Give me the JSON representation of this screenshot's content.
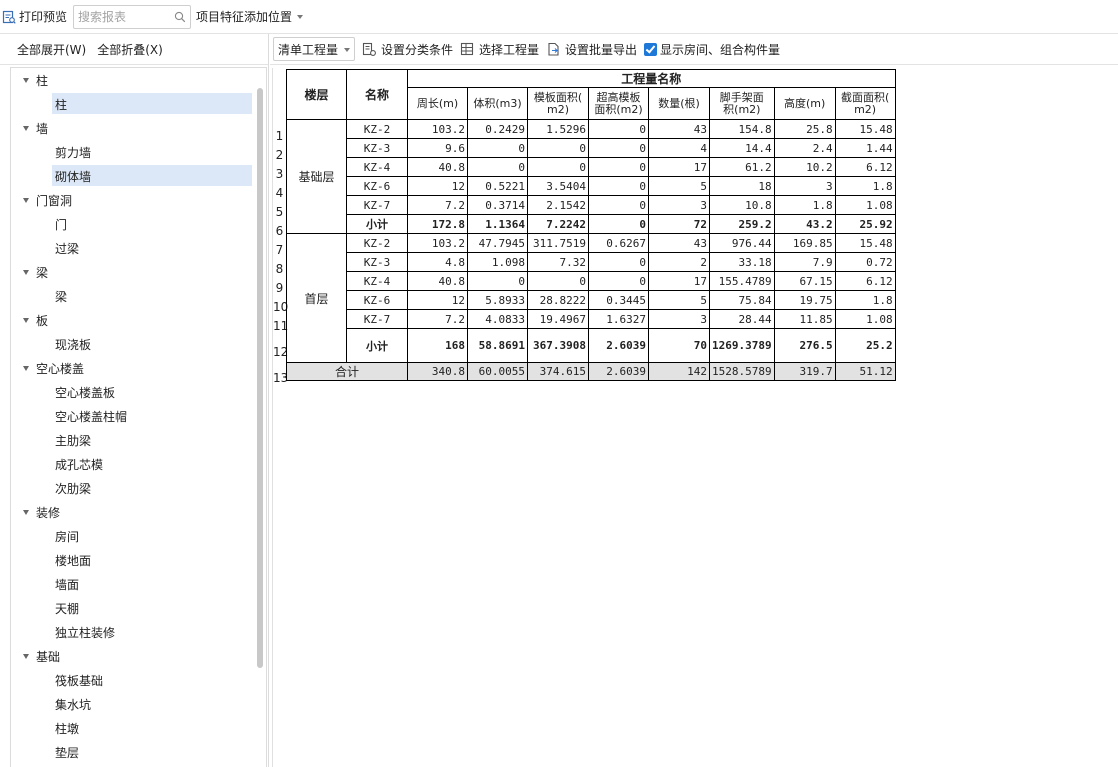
{
  "toolbar": {
    "print_preview": "打印预览",
    "search_placeholder": "搜索报表",
    "feature_position": "项目特征添加位置"
  },
  "left": {
    "expand_all": "全部展开(W)",
    "collapse_all": "全部折叠(X)",
    "tree": [
      {
        "label": "柱",
        "children": [
          {
            "label": "柱",
            "selected": true
          }
        ]
      },
      {
        "label": "墙",
        "children": [
          {
            "label": "剪力墙"
          },
          {
            "label": "砌体墙",
            "selected": true
          }
        ]
      },
      {
        "label": "门窗洞",
        "children": [
          {
            "label": "门"
          },
          {
            "label": "过梁"
          }
        ]
      },
      {
        "label": "梁",
        "children": [
          {
            "label": "梁"
          }
        ]
      },
      {
        "label": "板",
        "children": [
          {
            "label": "现浇板"
          }
        ]
      },
      {
        "label": "空心楼盖",
        "children": [
          {
            "label": "空心楼盖板"
          },
          {
            "label": "空心楼盖柱帽"
          },
          {
            "label": "主肋梁"
          },
          {
            "label": "成孔芯模"
          },
          {
            "label": "次肋梁"
          }
        ]
      },
      {
        "label": "装修",
        "children": [
          {
            "label": "房间"
          },
          {
            "label": "楼地面"
          },
          {
            "label": "墙面"
          },
          {
            "label": "天棚"
          },
          {
            "label": "独立柱装修"
          }
        ]
      },
      {
        "label": "基础",
        "children": [
          {
            "label": "筏板基础"
          },
          {
            "label": "集水坑"
          },
          {
            "label": "柱墩"
          },
          {
            "label": "垫层"
          }
        ]
      }
    ]
  },
  "right_toolbar": {
    "dropdown": "清单工程量",
    "set_classify": "设置分类条件",
    "select_quantity": "选择工程量",
    "set_batch_export": "设置批量导出",
    "show_rooms": "显示房间、组合构件量",
    "show_rooms_checked": true
  },
  "report": {
    "header_floor": "楼层",
    "header_name": "名称",
    "header_group": "工程量名称",
    "columns": [
      "周长(m)",
      "体积(m3)",
      "模板面积(m2)",
      "超高模板面积(m2)",
      "数量(根)",
      "脚手架面积(m2)",
      "高度(m)",
      "截面面积(m2)"
    ],
    "column_lines": [
      [
        "周长(m)"
      ],
      [
        "体积(m3)"
      ],
      [
        "模板面积(",
        "m2)"
      ],
      [
        "超高模板",
        "面积(m2)"
      ],
      [
        "数量(根)"
      ],
      [
        "脚手架面",
        "积(m2)"
      ],
      [
        "高度(m)"
      ],
      [
        "截面面积(",
        "m2)"
      ]
    ],
    "floors": [
      {
        "name": "基础层",
        "rows": [
          {
            "num": "1",
            "name": "KZ-2",
            "values": [
              "103.2",
              "0.2429",
              "1.5296",
              "0",
              "43",
              "154.8",
              "25.8",
              "15.48"
            ]
          },
          {
            "num": "2",
            "name": "KZ-3",
            "values": [
              "9.6",
              "0",
              "0",
              "0",
              "4",
              "14.4",
              "2.4",
              "1.44"
            ]
          },
          {
            "num": "3",
            "name": "KZ-4",
            "values": [
              "40.8",
              "0",
              "0",
              "0",
              "17",
              "61.2",
              "10.2",
              "6.12"
            ]
          },
          {
            "num": "4",
            "name": "KZ-6",
            "values": [
              "12",
              "0.5221",
              "3.5404",
              "0",
              "5",
              "18",
              "3",
              "1.8"
            ]
          },
          {
            "num": "5",
            "name": "KZ-7",
            "values": [
              "7.2",
              "0.3714",
              "2.1542",
              "0",
              "3",
              "10.8",
              "1.8",
              "1.08"
            ]
          }
        ],
        "subtotal": {
          "num": "6",
          "name": "小计",
          "values": [
            "172.8",
            "1.1364",
            "7.2242",
            "0",
            "72",
            "259.2",
            "43.2",
            "25.92"
          ]
        }
      },
      {
        "name": "首层",
        "rows": [
          {
            "num": "7",
            "name": "KZ-2",
            "values": [
              "103.2",
              "47.7945",
              "311.7519",
              "0.6267",
              "43",
              "976.44",
              "169.85",
              "15.48"
            ]
          },
          {
            "num": "8",
            "name": "KZ-3",
            "values": [
              "4.8",
              "1.098",
              "7.32",
              "0",
              "2",
              "33.18",
              "7.9",
              "0.72"
            ]
          },
          {
            "num": "9",
            "name": "KZ-4",
            "values": [
              "40.8",
              "0",
              "0",
              "0",
              "17",
              "155.4789",
              "67.15",
              "6.12"
            ]
          },
          {
            "num": "10",
            "name": "KZ-6",
            "values": [
              "12",
              "5.8933",
              "28.8222",
              "0.3445",
              "5",
              "75.84",
              "19.75",
              "1.8"
            ]
          },
          {
            "num": "11",
            "name": "KZ-7",
            "values": [
              "7.2",
              "4.0833",
              "19.4967",
              "1.6327",
              "3",
              "28.44",
              "11.85",
              "1.08"
            ]
          }
        ],
        "subtotal": {
          "num": "12",
          "name": "小计",
          "values": [
            "168",
            "58.8691",
            "367.3908",
            "2.6039",
            "70",
            "1269.3789",
            "276.5",
            "25.2"
          ]
        }
      }
    ],
    "total": {
      "num": "13",
      "label": "合计",
      "values": [
        "340.8",
        "60.0055",
        "374.615",
        "2.6039",
        "142",
        "1528.5789",
        "319.7",
        "51.12"
      ]
    }
  }
}
